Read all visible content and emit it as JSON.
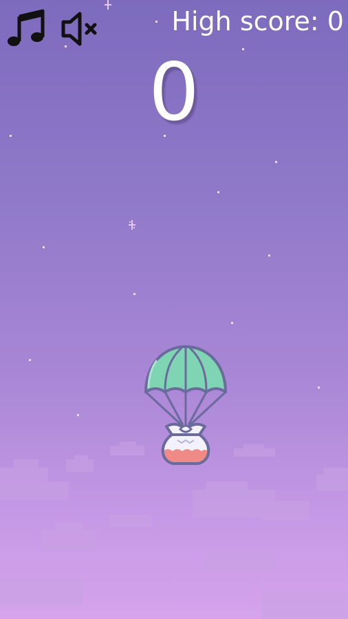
{
  "hud": {
    "music_icon": "music-note-icon",
    "sound_icon": "speaker-muted-icon",
    "high_score_label": "High score: 0",
    "current_score": "0"
  },
  "player": {
    "icon": "parachute-crate-icon"
  },
  "colors": {
    "sky_top": "#7d6bbd",
    "sky_bottom": "#d6a3ec",
    "canopy": "#7fd4b4",
    "outline": "#6b6a9c",
    "crate": "#f4f1ff",
    "crate_band": "#f08a86",
    "text": "#ffffff"
  }
}
